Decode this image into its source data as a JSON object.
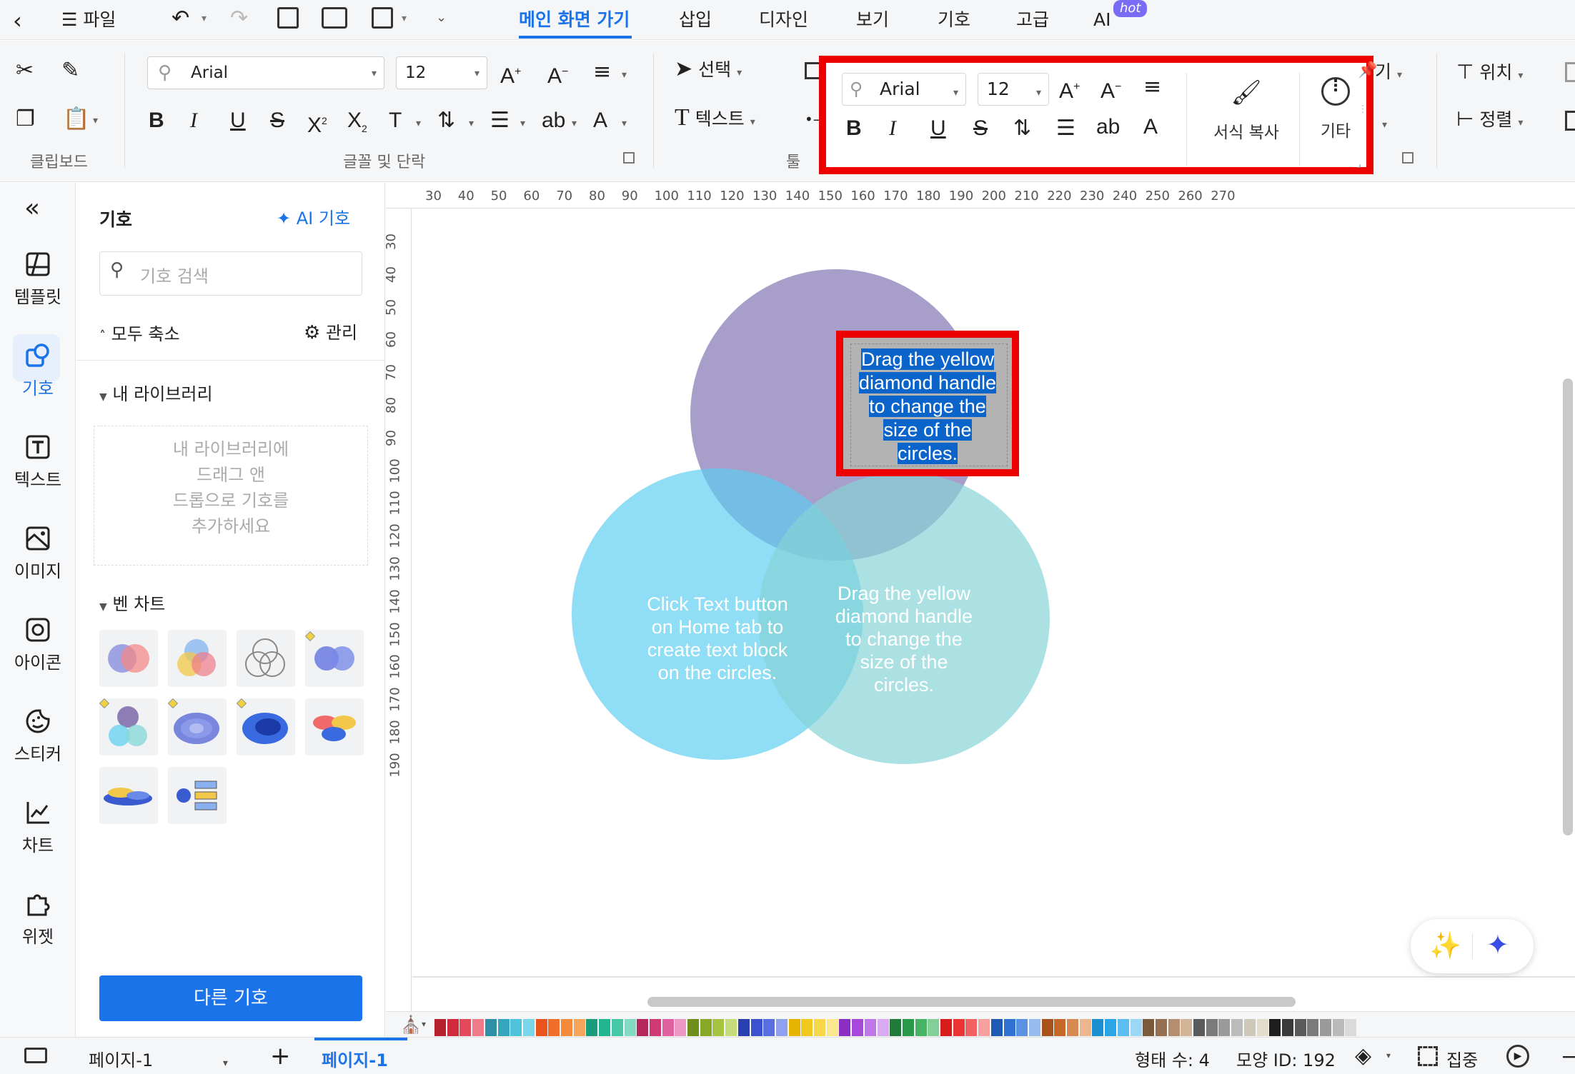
{
  "menubar": {
    "file_label": "파일",
    "tabs": [
      "메인 화면 가기",
      "삽입",
      "디자인",
      "보기",
      "기호",
      "고급",
      "AI"
    ],
    "hot_badge": "hot"
  },
  "ribbon": {
    "font_name": "Arial",
    "font_size": "12",
    "select_label": "선택",
    "text_label": "텍스트",
    "position_label": "위치",
    "align_label": "정렬",
    "partial_label": "기",
    "groups": [
      "클립보드",
      "글꼴 및 단락",
      "툴"
    ]
  },
  "mini_toolbar": {
    "font_name": "Arial",
    "font_size": "12",
    "format_copy_label": "서식 복사",
    "more_label": "기타"
  },
  "rail": {
    "items": [
      "템플릿",
      "기호",
      "텍스트",
      "이미지",
      "아이콘",
      "스티커",
      "차트",
      "위젯"
    ],
    "active": "기호"
  },
  "panel": {
    "title": "기호",
    "ai_label": "AI 기호",
    "search_placeholder": "기호 검색",
    "collapse_all": "모두 축소",
    "manage": "관리",
    "my_library": "내 라이브러리",
    "library_hint": [
      "내 라이브러리에",
      "드래그 앤",
      "드롭으로 기호를",
      "추가하세요"
    ],
    "venn_section": "벤 차트",
    "more_symbols": "다른 기호"
  },
  "rulers": {
    "h": [
      "30",
      "40",
      "50",
      "60",
      "70",
      "80",
      "90",
      "100",
      "110",
      "120",
      "130",
      "140",
      "150",
      "160",
      "170",
      "180",
      "190",
      "200",
      "210",
      "220",
      "230",
      "240",
      "250",
      "260",
      "270"
    ],
    "v": [
      "30",
      "40",
      "50",
      "60",
      "70",
      "80",
      "90",
      "100",
      "110",
      "120",
      "130",
      "140",
      "150",
      "160",
      "170",
      "180",
      "190"
    ]
  },
  "canvas": {
    "top_text": [
      "Drag the yellow",
      "diamond handle",
      "to change the",
      "size of the",
      "circles."
    ],
    "left_text": [
      "Click Text button",
      "on Home tab to",
      "create text block",
      "on the circles."
    ],
    "right_text": [
      "Drag the yellow",
      "diamond handle",
      "to change the",
      "size of the",
      "circles."
    ],
    "colors": {
      "top": "#9b8ec0",
      "left": "#6cd2f3",
      "right": "#8ed8db"
    }
  },
  "palette": [
    "#b7202e",
    "#d02a3c",
    "#e4495a",
    "#ee7a8a",
    "#2f8fa4",
    "#36a6bf",
    "#4ec3da",
    "#7ad7ea",
    "#e8541c",
    "#f06d2a",
    "#f48a3a",
    "#f6a55a",
    "#1a9b7c",
    "#22b591",
    "#47c7a6",
    "#84dbc3",
    "#b4285a",
    "#cf3a74",
    "#e060a0",
    "#ee99c4",
    "#6e8f1c",
    "#88a826",
    "#a6c440",
    "#c6dc7a",
    "#2a3fb0",
    "#3a52cf",
    "#5a6ee0",
    "#8ea0ee",
    "#e6b400",
    "#f2c81c",
    "#f7d64a",
    "#fbe78e",
    "#8c2fc4",
    "#a648dc",
    "#bf78e8",
    "#d9aaf2",
    "#1e7b3a",
    "#2a9a4a",
    "#46b463",
    "#84cf98",
    "#d81b1b",
    "#ec3434",
    "#f26262",
    "#f7a0a0",
    "#1e5ab4",
    "#2f72d2",
    "#5a92e2",
    "#98bcee",
    "#a8511a",
    "#c4682a",
    "#d88a50",
    "#ecb68e",
    "#1a8fd0",
    "#2aa6e6",
    "#5cbef0",
    "#9ad8f6",
    "#7a5a3a",
    "#967050",
    "#b48e6e",
    "#d2b498",
    "#5a5a5a",
    "#7a7a7a",
    "#9a9a9a",
    "#bcbcbc",
    "#cfc8b8",
    "#e2dccc",
    "#1e1e1e",
    "#3a3a3a",
    "#5a5a5a",
    "#7a7a7a",
    "#9a9a9a",
    "#bababa",
    "#dadada"
  ],
  "status": {
    "page_select": "페이지-1",
    "page_tab": "페이지-1",
    "shape_count": "형태 수: 4",
    "shape_id": "모양 ID: 192",
    "focus": "집중"
  }
}
